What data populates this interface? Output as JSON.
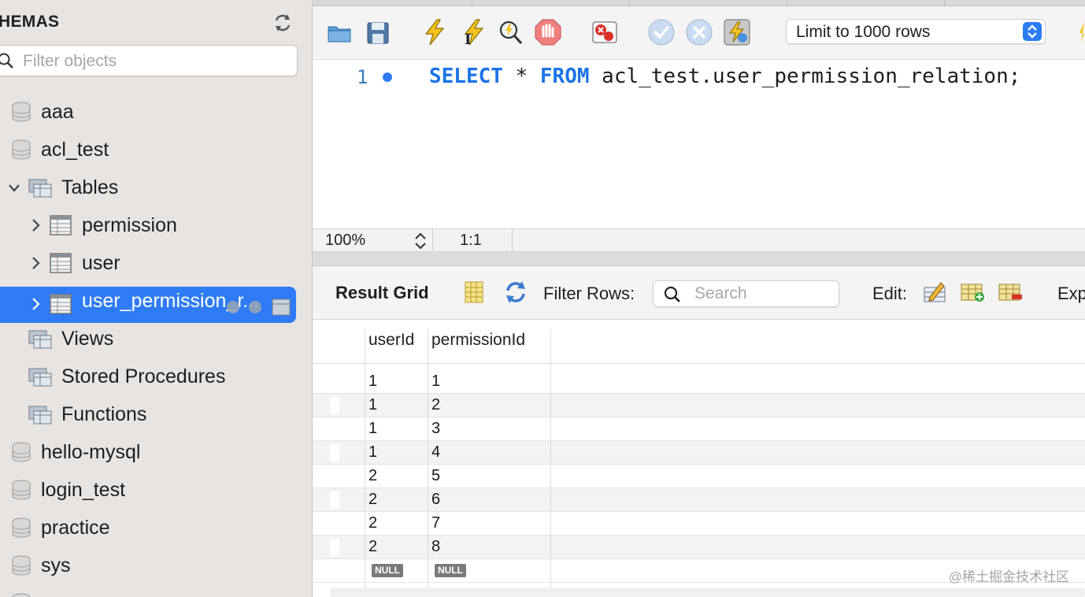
{
  "sidebar": {
    "title": "HEMAS",
    "filter_placeholder": "Filter objects",
    "tree": [
      {
        "label": "aaa",
        "type": "schema"
      },
      {
        "label": "acl_test",
        "type": "schema"
      },
      {
        "label": "Tables",
        "type": "folder",
        "expanded": true
      },
      {
        "label": "permission",
        "type": "table"
      },
      {
        "label": "user",
        "type": "table"
      },
      {
        "label": "user_permission_r...",
        "type": "table",
        "selected": true
      },
      {
        "label": "Views",
        "type": "folder"
      },
      {
        "label": "Stored Procedures",
        "type": "folder"
      },
      {
        "label": "Functions",
        "type": "folder"
      },
      {
        "label": "hello-mysql",
        "type": "schema"
      },
      {
        "label": "login_test",
        "type": "schema"
      },
      {
        "label": "practice",
        "type": "schema"
      },
      {
        "label": "sys",
        "type": "schema"
      }
    ]
  },
  "toolbar": {
    "icons": [
      "open-folder-icon",
      "save-icon",
      "execute-icon",
      "execute-statement-icon",
      "explain-icon",
      "stop-icon",
      "toggle-error-icon",
      "commit-icon",
      "rollback-icon",
      "autocommit-icon"
    ],
    "limit_value": "Limit to 1000 rows"
  },
  "editor": {
    "line_number": "1",
    "keyword_select": "SELECT",
    "star": " * ",
    "keyword_from": "FROM",
    "rest": " acl_test.user_permission_relation;"
  },
  "status_bar": {
    "zoom": "100%",
    "cursor": "1:1"
  },
  "result_toolbar": {
    "title": "Result Grid",
    "filter_label": "Filter Rows:",
    "search_placeholder": "Search",
    "edit_label": "Edit:",
    "export_label": "Exp"
  },
  "grid": {
    "columns": [
      "userId",
      "permissionId"
    ],
    "rows": [
      [
        "1",
        "1"
      ],
      [
        "1",
        "2"
      ],
      [
        "1",
        "3"
      ],
      [
        "1",
        "4"
      ],
      [
        "2",
        "5"
      ],
      [
        "2",
        "6"
      ],
      [
        "2",
        "7"
      ],
      [
        "2",
        "8"
      ]
    ],
    "null_label": "NULL"
  },
  "watermark": "@稀土掘金技术社区",
  "colors": {
    "accent": "#2f7bf5",
    "keyword": "#1a73e8",
    "sidebar_bg": "#e8e4e1"
  }
}
